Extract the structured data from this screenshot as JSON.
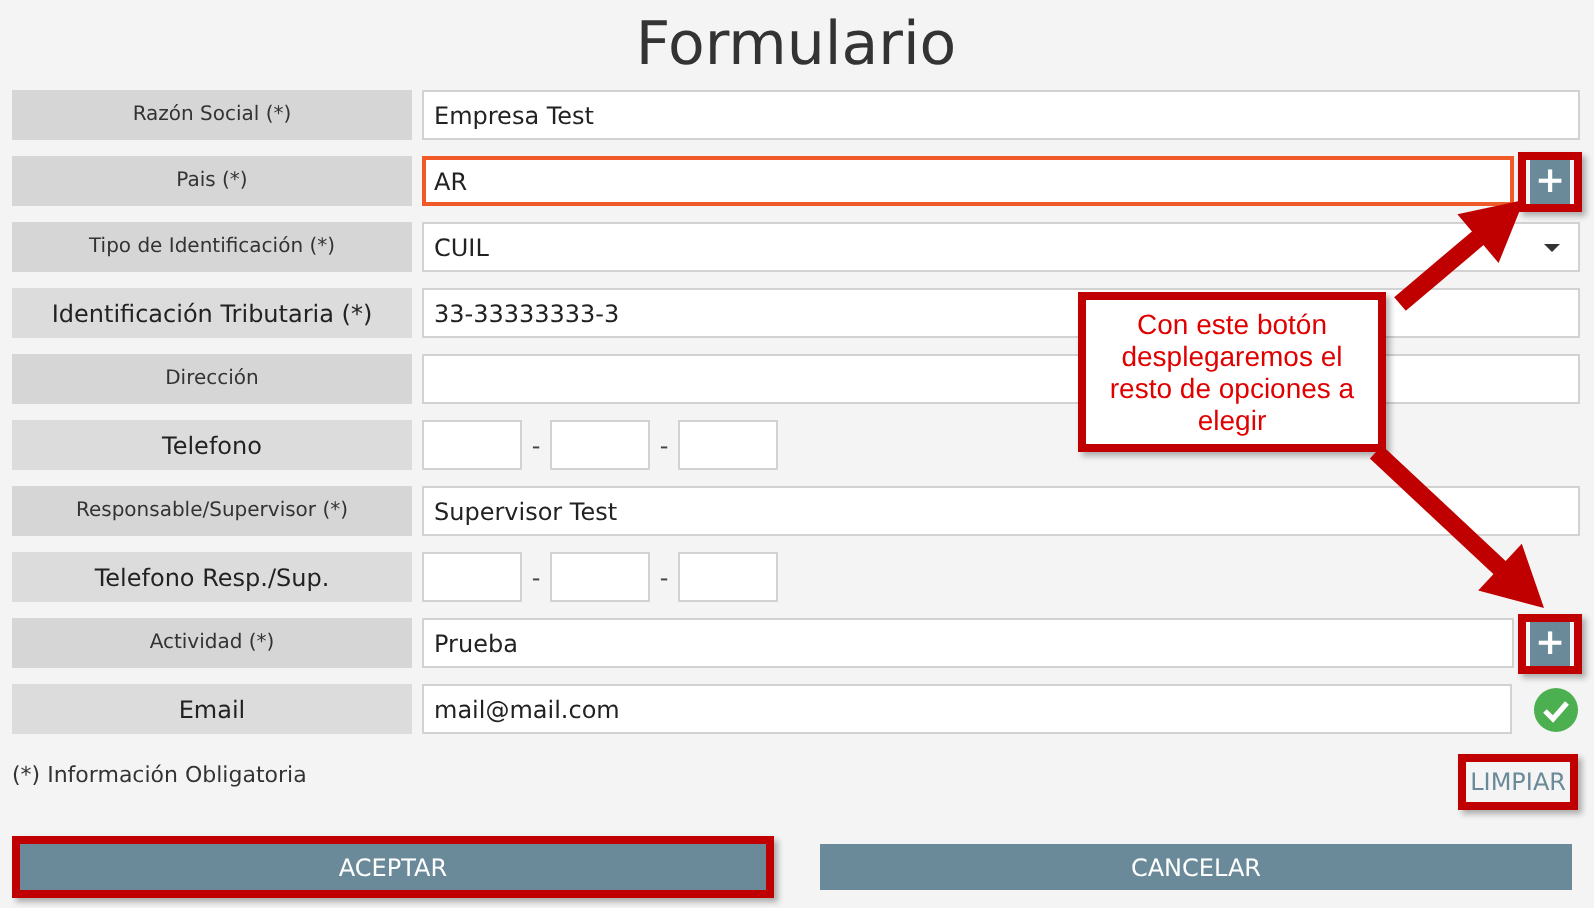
{
  "title": "Formulario",
  "rows": [
    {
      "label": "Razón Social (*)",
      "large": false,
      "kind": "text",
      "value": "Empresa Test"
    },
    {
      "label": "Pais (*)",
      "large": false,
      "kind": "text",
      "value": "AR",
      "focused": true,
      "add_button": {
        "label": "+",
        "highlighted": true
      }
    },
    {
      "label": "Tipo de Identificación (*)",
      "large": false,
      "kind": "select",
      "value": "CUIL"
    },
    {
      "label": "Identificación Tributaria (*)",
      "large": true,
      "kind": "text",
      "value": "33-33333333-3"
    },
    {
      "label": "Dirección",
      "large": false,
      "kind": "text"
    },
    {
      "label": "Telefono",
      "large": true,
      "kind": "phone",
      "separators": [
        "-",
        "-"
      ]
    },
    {
      "label": "Responsable/Supervisor (*)",
      "large": false,
      "kind": "text",
      "value": "Supervisor Test"
    },
    {
      "label": "Telefono Resp./Sup.",
      "large": true,
      "kind": "phone",
      "separators": [
        "-",
        "-"
      ]
    },
    {
      "label": "Actividad (*)",
      "large": false,
      "kind": "text",
      "value": "Prueba",
      "add_button": {
        "label": "+",
        "highlighted": true
      }
    },
    {
      "label": "Email",
      "large": true,
      "kind": "text",
      "value": "mail@mail.com",
      "valid": true
    }
  ],
  "note": "(*) Información Obligatoria",
  "clear_button": {
    "label": "LIMPIAR",
    "highlighted": true
  },
  "buttons": [
    {
      "label": "ACEPTAR",
      "highlighted": true
    },
    {
      "label": "CANCELAR",
      "highlighted": false
    }
  ],
  "callout": {
    "text": "Con este botón desplegaremos el resto de opciones a elegir"
  }
}
